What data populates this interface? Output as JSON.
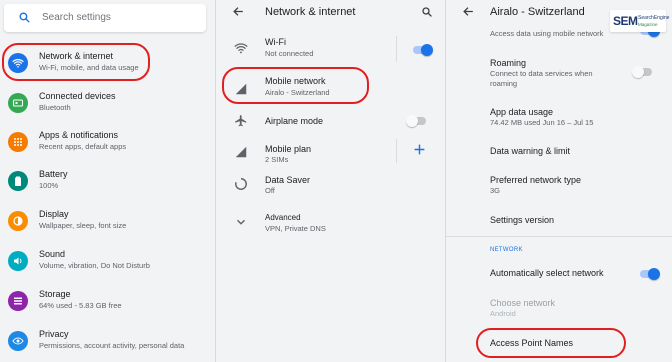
{
  "panel1": {
    "search_placeholder": "Search settings",
    "items": [
      {
        "title": "Network & internet",
        "subtitle": "Wi-Fi, mobile, and data usage",
        "icon": "wifi-icon",
        "color": "#1a73e8"
      },
      {
        "title": "Connected devices",
        "subtitle": "Bluetooth",
        "icon": "devices-icon",
        "color": "#34a853"
      },
      {
        "title": "Apps & notifications",
        "subtitle": "Recent apps, default apps",
        "icon": "apps-icon",
        "color": "#f57c00"
      },
      {
        "title": "Battery",
        "subtitle": "100%",
        "icon": "battery-icon",
        "color": "#00897b"
      },
      {
        "title": "Display",
        "subtitle": "Wallpaper, sleep, font size",
        "icon": "display-icon",
        "color": "#fb8c00"
      },
      {
        "title": "Sound",
        "subtitle": "Volume, vibration, Do Not Disturb",
        "icon": "sound-icon",
        "color": "#00acc1"
      },
      {
        "title": "Storage",
        "subtitle": "64% used - 5.83 GB free",
        "icon": "storage-icon",
        "color": "#8e24aa"
      },
      {
        "title": "Privacy",
        "subtitle": "Permissions, account activity, personal data",
        "icon": "privacy-icon",
        "color": "#1e88e5"
      }
    ]
  },
  "panel2": {
    "title": "Network & internet",
    "items": [
      {
        "title": "Wi-Fi",
        "subtitle": "Not connected",
        "icon": "wifi-icon",
        "control": "toggle-on"
      },
      {
        "title": "Mobile network",
        "subtitle": "Airalo - Switzerland",
        "icon": "signal-icon",
        "control": ""
      },
      {
        "title": "Airplane mode",
        "subtitle": "",
        "icon": "airplane-icon",
        "control": "toggle-off"
      },
      {
        "title": "Mobile plan",
        "subtitle": "2 SIMs",
        "icon": "signal-icon",
        "control": "plus"
      },
      {
        "title": "Data Saver",
        "subtitle": "Off",
        "icon": "data-saver-icon",
        "control": ""
      },
      {
        "title": "Advanced",
        "subtitle": "VPN, Private DNS",
        "icon": "chevron-down-icon",
        "control": ""
      }
    ]
  },
  "panel3": {
    "title": "Airalo - Switzerland",
    "top_partial": "Access data using mobile network",
    "items": [
      {
        "title": "Roaming",
        "subtitle": "Connect to data services when roaming"
      },
      {
        "title": "App data usage",
        "subtitle": "74.42 MB used Jun 16 – Jul 15"
      },
      {
        "title": "Data warning & limit",
        "subtitle": ""
      },
      {
        "title": "Preferred network type",
        "subtitle": "3G"
      },
      {
        "title": "Settings version",
        "subtitle": ""
      }
    ],
    "section_label": "NETWORK",
    "auto_select": "Automatically select network",
    "choose_network": {
      "title": "Choose network",
      "subtitle": "Android"
    },
    "apn": "Access Point Names"
  },
  "logo": {
    "big": "SEM",
    "small_top": "SearchEngine",
    "small_bottom": "Magazine"
  },
  "colors": {
    "accent": "#1a73e8",
    "highlight": "#e02020",
    "background": "#f1f3f4"
  }
}
